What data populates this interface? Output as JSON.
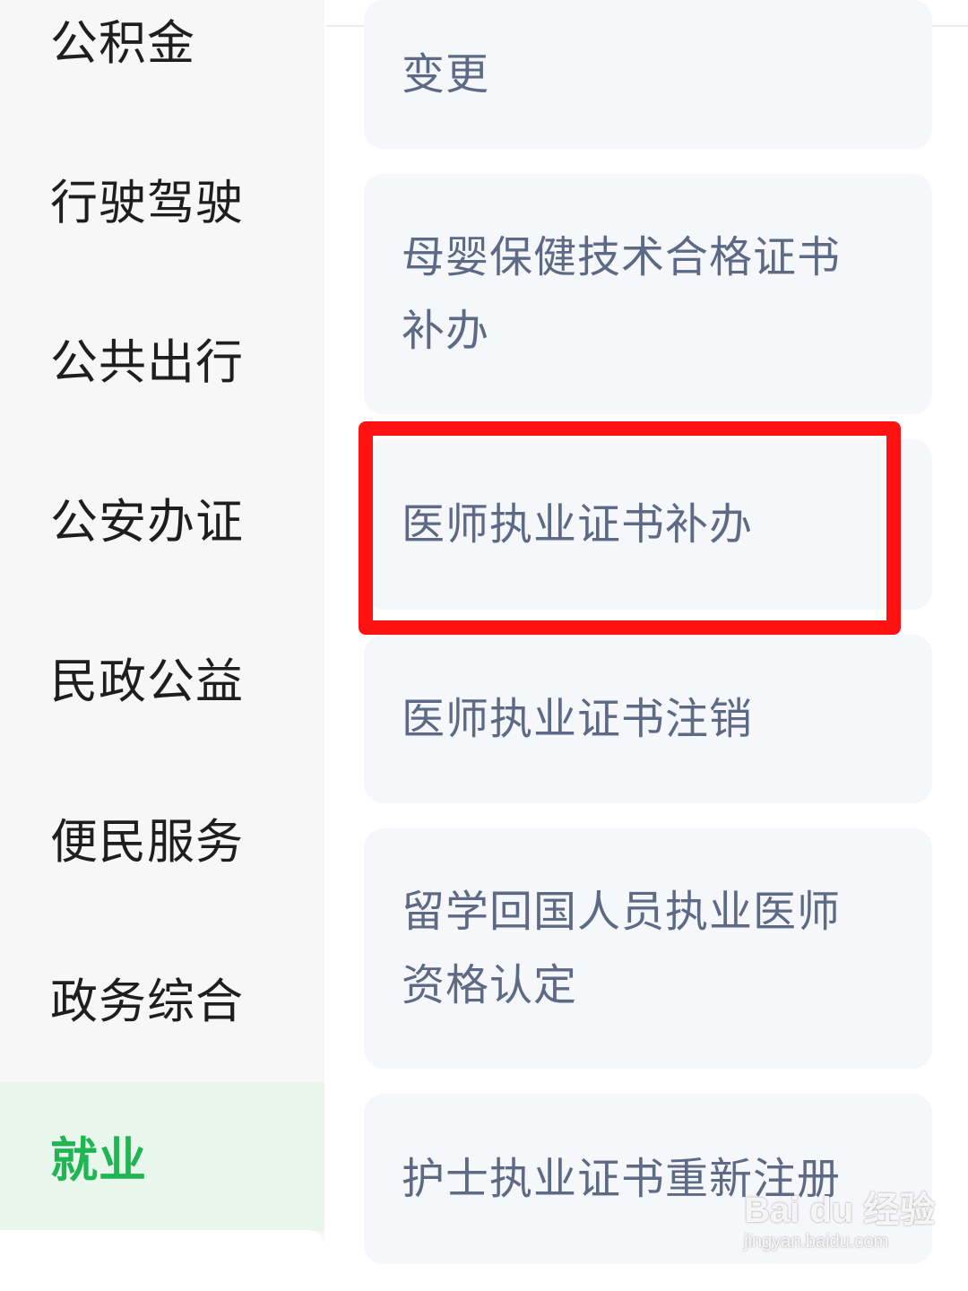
{
  "sidebar": {
    "items": [
      {
        "label": "公积金"
      },
      {
        "label": "行驶驾驶"
      },
      {
        "label": "公共出行"
      },
      {
        "label": "公安办证"
      },
      {
        "label": "民政公益"
      },
      {
        "label": "便民服务"
      },
      {
        "label": "政务综合"
      },
      {
        "label": "就业",
        "active": true
      }
    ]
  },
  "services": {
    "items": [
      {
        "line1": "变更",
        "line2": ""
      },
      {
        "line1": "母婴保健技术合格证书",
        "line2": "补办"
      },
      {
        "line1": "医师执业证书补办",
        "line2": "",
        "highlighted": true
      },
      {
        "line1": "医师执业证书注销",
        "line2": ""
      },
      {
        "line1": "留学回国人员执业医师",
        "line2": "资格认定"
      },
      {
        "line1": "护士执业证书重新注册",
        "line2": ""
      }
    ]
  },
  "watermark": {
    "brand": "Bai du 经验",
    "url": "jingyan.baidu.com"
  },
  "colors": {
    "active": "#1fb553",
    "active_bg": "#e9f6ec",
    "card_text": "#5d6a86",
    "highlight_box": "#ff1212"
  }
}
